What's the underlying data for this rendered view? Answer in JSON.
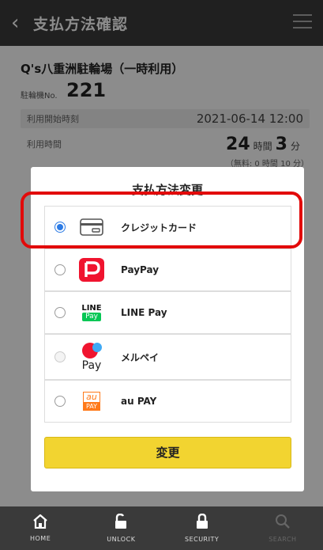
{
  "header": {
    "back_icon": "chevron-left-icon",
    "title": "支払方法確認",
    "menu_icon": "hamburger-icon"
  },
  "background": {
    "lot_name": "Q's八重洲駐輪場（一時利用）",
    "no_label": "駐輪機No.",
    "no_value": "221",
    "start_label": "利用開始時刻",
    "start_value": "2021-06-14 12:00",
    "duration_label": "利用時間",
    "duration_hours": "24",
    "duration_hours_unit": "時間",
    "duration_minutes": "3",
    "duration_minutes_unit": "分",
    "free_note": "（無料: 0 時間 10 分）"
  },
  "modal": {
    "title": "支払方法変更",
    "options": [
      {
        "label": "クレジットカード",
        "icon": "credit-card-icon",
        "selected": true
      },
      {
        "label": "PayPay",
        "icon": "paypay-icon",
        "selected": false
      },
      {
        "label": "LINE Pay",
        "icon": "line-pay-icon",
        "icon_text_top": "LINE",
        "icon_text_bottom": "Pay",
        "selected": false
      },
      {
        "label": "メルペイ",
        "icon": "merpay-icon",
        "icon_text": "Pay",
        "selected": false,
        "disabled": true
      },
      {
        "label": "au PAY",
        "icon": "au-pay-icon",
        "icon_text_top": "au",
        "icon_text_bottom": "PAY",
        "selected": false
      }
    ],
    "change_button": "変更"
  },
  "tabs": [
    {
      "label": "HOME",
      "icon": "home-icon"
    },
    {
      "label": "UNLOCK",
      "icon": "unlock-icon"
    },
    {
      "label": "SECURITY",
      "icon": "lock-icon"
    },
    {
      "label": "SEARCH",
      "icon": "search-icon",
      "disabled": true
    }
  ],
  "colors": {
    "accent": "#2c7be5",
    "highlight": "#e20a0a",
    "button": "#f2d430",
    "header": "#3b3b3b"
  }
}
